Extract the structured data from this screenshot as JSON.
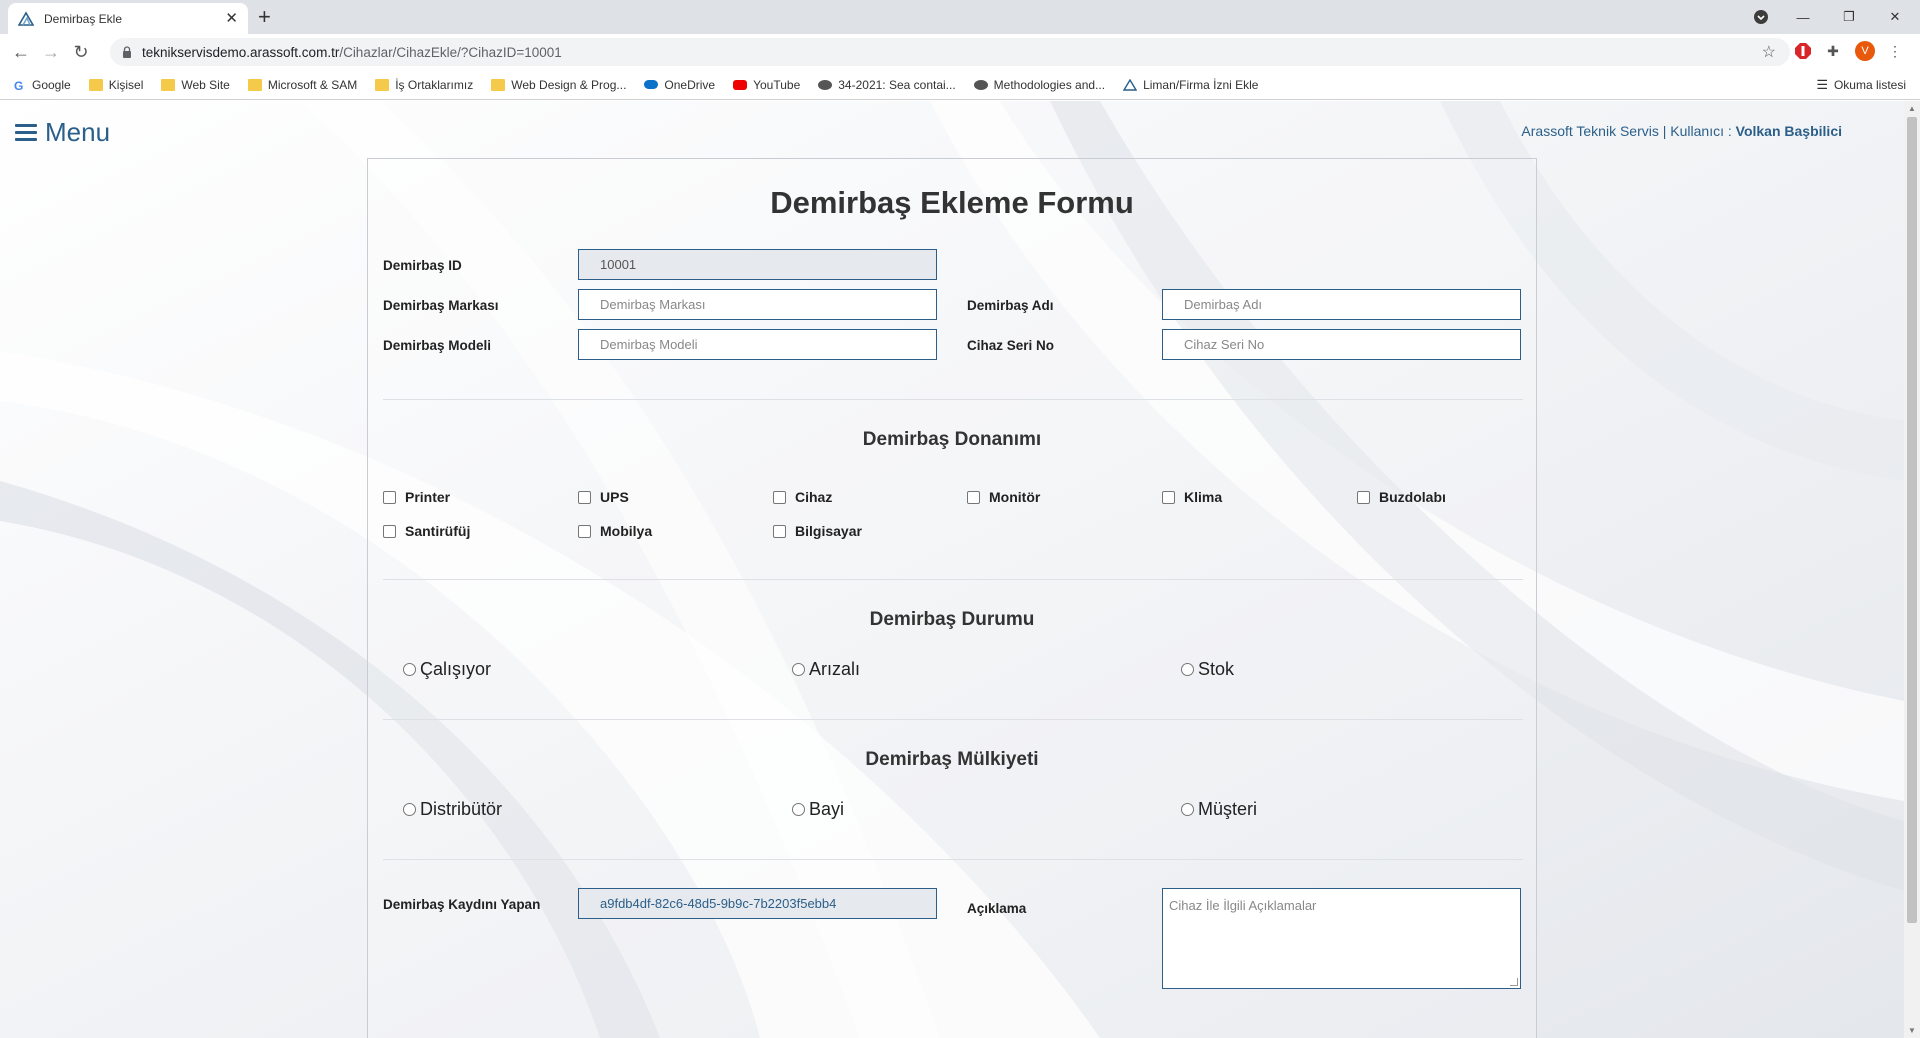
{
  "browser": {
    "tab_title": "Demirbaş Ekle",
    "url_host": "teknikservisdemo.arassoft.com.tr",
    "url_path": "/Cihazlar/CihazEkle/?CihazID=10001",
    "profile_initial": "V",
    "bookmarks": [
      "Google",
      "Kişisel",
      "Web Site",
      "Microsoft & SAM",
      "İş Ortaklarımız",
      "Web Design & Prog...",
      "OneDrive",
      "YouTube",
      "34-2021: Sea contai...",
      "Methodologies and...",
      "Liman/Firma İzni Ekle"
    ],
    "reading_list": "Okuma listesi"
  },
  "header": {
    "menu_label": "Menu",
    "company": "Arassoft Teknik Servis",
    "user_prefix": " | Kullanıcı : ",
    "user_name": "Volkan Başbilici"
  },
  "form": {
    "title": "Demirbaş Ekleme Formu",
    "id_label": "Demirbaş ID",
    "id_value": "10001",
    "brand_label": "Demirbaş Markası",
    "brand_placeholder": "Demirbaş Markası",
    "name_label": "Demirbaş Adı",
    "name_placeholder": "Demirbaş Adı",
    "model_label": "Demirbaş Modeli",
    "model_placeholder": "Demirbaş Modeli",
    "serial_label": "Cihaz Seri No",
    "serial_placeholder": "Cihaz Seri No",
    "hardware_title": "Demirbaş Donanımı",
    "hardware": [
      "Printer",
      "UPS",
      "Cihaz",
      "Monitör",
      "Klima",
      "Buzdolabı",
      "Santirüfüj",
      "Mobilya",
      "Bilgisayar"
    ],
    "status_title": "Demirbaş Durumu",
    "status": [
      "Çalışıyor",
      "Arızalı",
      "Stok"
    ],
    "ownership_title": "Demirbaş Mülkiyeti",
    "ownership": [
      "Distribütör",
      "Bayi",
      "Müşteri"
    ],
    "recorder_label": "Demirbaş Kaydını Yapan",
    "recorder_value": "a9fdb4df-82c6-48d5-9b9c-7b2203f5ebb4",
    "desc_label": "Açıklama",
    "desc_placeholder": "Cihaz İle İlgili Açıklamalar"
  },
  "colors": {
    "accent": "#2b5f8a",
    "tab_bar": "#dee1e6"
  }
}
